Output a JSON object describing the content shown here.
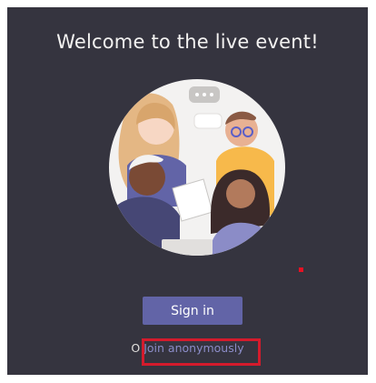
{
  "header": {
    "title": "Welcome to the live event!"
  },
  "actions": {
    "sign_in_label": "Sign in",
    "or_prefix": "O",
    "join_anonymously_label": "Join anonymously"
  },
  "colors": {
    "background": "#35343f",
    "primary_button": "#6264a7",
    "link": "#8b8cc7",
    "highlight_box": "#d41b2c"
  }
}
